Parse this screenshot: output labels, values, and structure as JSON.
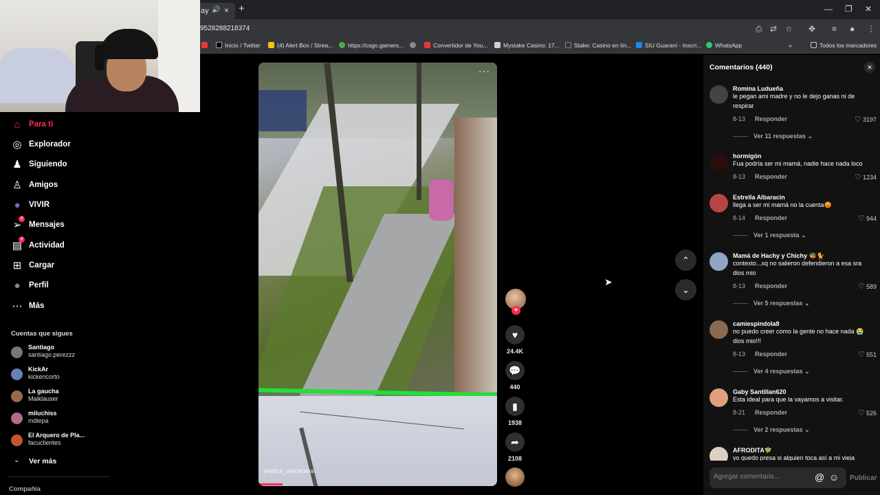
{
  "browser": {
    "tab_title": "ay",
    "url": "9528288218374",
    "bookmarks": [
      {
        "label": "Inicio / Twitter",
        "icon": "x-icon",
        "color": "#000000"
      },
      {
        "label": "(4) Alert Box / Strea...",
        "icon": "alertbox-icon",
        "color": "#f1c40f"
      },
      {
        "label": "https://csgo.gamers...",
        "icon": "csgo-icon",
        "color": "#4caf50"
      },
      {
        "label": "",
        "icon": "globe-icon",
        "color": "#888888"
      },
      {
        "label": "Convertidor de You...",
        "icon": "converter-icon",
        "color": "#e53935"
      },
      {
        "label": "Mystake Casino: 17...",
        "icon": "casino-icon",
        "color": "#cfcfcf"
      },
      {
        "label": "Stake: Casino en lín...",
        "icon": "stake-icon",
        "color": "#333333"
      },
      {
        "label": "SIU Guaraní - Inscri...",
        "icon": "siu-icon",
        "color": "#1e88e5"
      },
      {
        "label": "WhatsApp",
        "icon": "whatsapp-icon",
        "color": "#25d366"
      }
    ],
    "all_bookmarks": "Todos los marcadores"
  },
  "nav": {
    "items": [
      {
        "label": "Para ti",
        "icon": "home-icon",
        "glyph": "⌂"
      },
      {
        "label": "Explorador",
        "icon": "compass-icon",
        "glyph": "◎"
      },
      {
        "label": "Siguiendo",
        "icon": "following-icon",
        "glyph": "♟"
      },
      {
        "label": "Amigos",
        "icon": "friends-icon",
        "glyph": "♙"
      },
      {
        "label": "VIVIR",
        "icon": "live-icon",
        "glyph": "●"
      },
      {
        "label": "Mensajes",
        "icon": "messages-icon",
        "glyph": "➢",
        "badge": "4"
      },
      {
        "label": "Actividad",
        "icon": "activity-icon",
        "glyph": "▤",
        "badge": "4"
      },
      {
        "label": "Cargar",
        "icon": "upload-icon",
        "glyph": "⊞"
      },
      {
        "label": "Perfil",
        "icon": "profile-icon",
        "glyph": "●"
      },
      {
        "label": "Más",
        "icon": "more-icon",
        "glyph": "⋯"
      }
    ],
    "following_title": "Cuentas que sigues",
    "accounts": [
      {
        "name": "Santiago",
        "user": "santiago.perezzz",
        "color": "#777777"
      },
      {
        "name": "KickAr",
        "user": "kickencorto",
        "color": "#6a7fb8"
      },
      {
        "name": "La gaucha",
        "user": "Maiklauser",
        "color": "#9a6b4b"
      },
      {
        "name": "miluchiss",
        "user": "mdiepa",
        "color": "#b06a8c"
      },
      {
        "name": "El Arquero de Pla...",
        "user": "facuclientes",
        "color": "#c4562c"
      }
    ],
    "see_more": "Ver más",
    "company": "Compañía"
  },
  "video": {
    "author": "jessica_macarena",
    "more": "···",
    "progress": 0.1
  },
  "actions": {
    "likes": "24.4K",
    "comments": "440",
    "saves": "1938",
    "shares": "2108"
  },
  "comments": {
    "title": "Comentarios (440)",
    "placeholder": "Agregar comentario...",
    "publish": "Publicar",
    "reply_label": "Responder",
    "items": [
      {
        "user": "Romina Ludueña",
        "text": "le pegan ami madre y no le dejo ganas ni de respirar",
        "date": "8-13",
        "likes": "3197",
        "replies": "Ver 11 respuestas",
        "color": "#444444"
      },
      {
        "user": "hormigón",
        "text": "Fua podría ser mi mamá, nadie hace nada loco",
        "date": "8-13",
        "likes": "1234",
        "replies": "",
        "color": "#2a0d0d"
      },
      {
        "user": "Estrella Albaracin",
        "text": "llega a ser mi mamá no la cuenta😡",
        "date": "8-14",
        "likes": "944",
        "replies": "Ver 1 respuesta",
        "color": "#b84545"
      },
      {
        "user": "Mamá de Hachy y Chichy 🐝🐈",
        "text": "contexto...xq no salieron defendieron a esa sra dios mio",
        "date": "8-13",
        "likes": "589",
        "replies": "Ver 5 respuestas",
        "color": "#8ca6c4"
      },
      {
        "user": "camiespindola8",
        "text": "no puedo creer como la gente no hace nada 😭 dios mio!!!",
        "date": "8-13",
        "likes": "551",
        "replies": "Ver 4 respuestas",
        "color": "#8a6a50"
      },
      {
        "user": "Gaby Santillan620",
        "text": "Esta ideal para que la vayamos a visitar.",
        "date": "8-21",
        "likes": "526",
        "replies": "Ver 2 respuestas",
        "color": "#e0a080"
      },
      {
        "user": "AFRODITA🧚",
        "text": "yo quedo presa si alguien toca así a mi vieja",
        "date": "",
        "likes": "",
        "replies": "",
        "color": "#ddd0c0"
      }
    ]
  }
}
